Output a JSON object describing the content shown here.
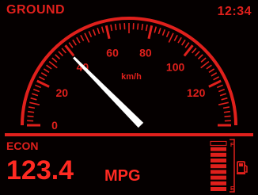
{
  "header": {
    "mode": "GROUND",
    "time": "12:34"
  },
  "speedometer": {
    "unit_label": "km/h",
    "scale_labels": [
      "0",
      "20",
      "40",
      "60",
      "80",
      "100",
      "120"
    ],
    "needle_value": 40,
    "min": 0,
    "max": 140
  },
  "economy": {
    "label": "ECON",
    "value": "123.4",
    "unit": "MPG"
  },
  "fuel": {
    "level_fraction": 0.9,
    "top_label": "F",
    "bottom_label": "E",
    "icon": "fuel-pump-icon"
  },
  "colors": {
    "primary": "#e0201c",
    "bright": "#ff2a22",
    "needle": "#ffffff",
    "background": "#050000"
  }
}
